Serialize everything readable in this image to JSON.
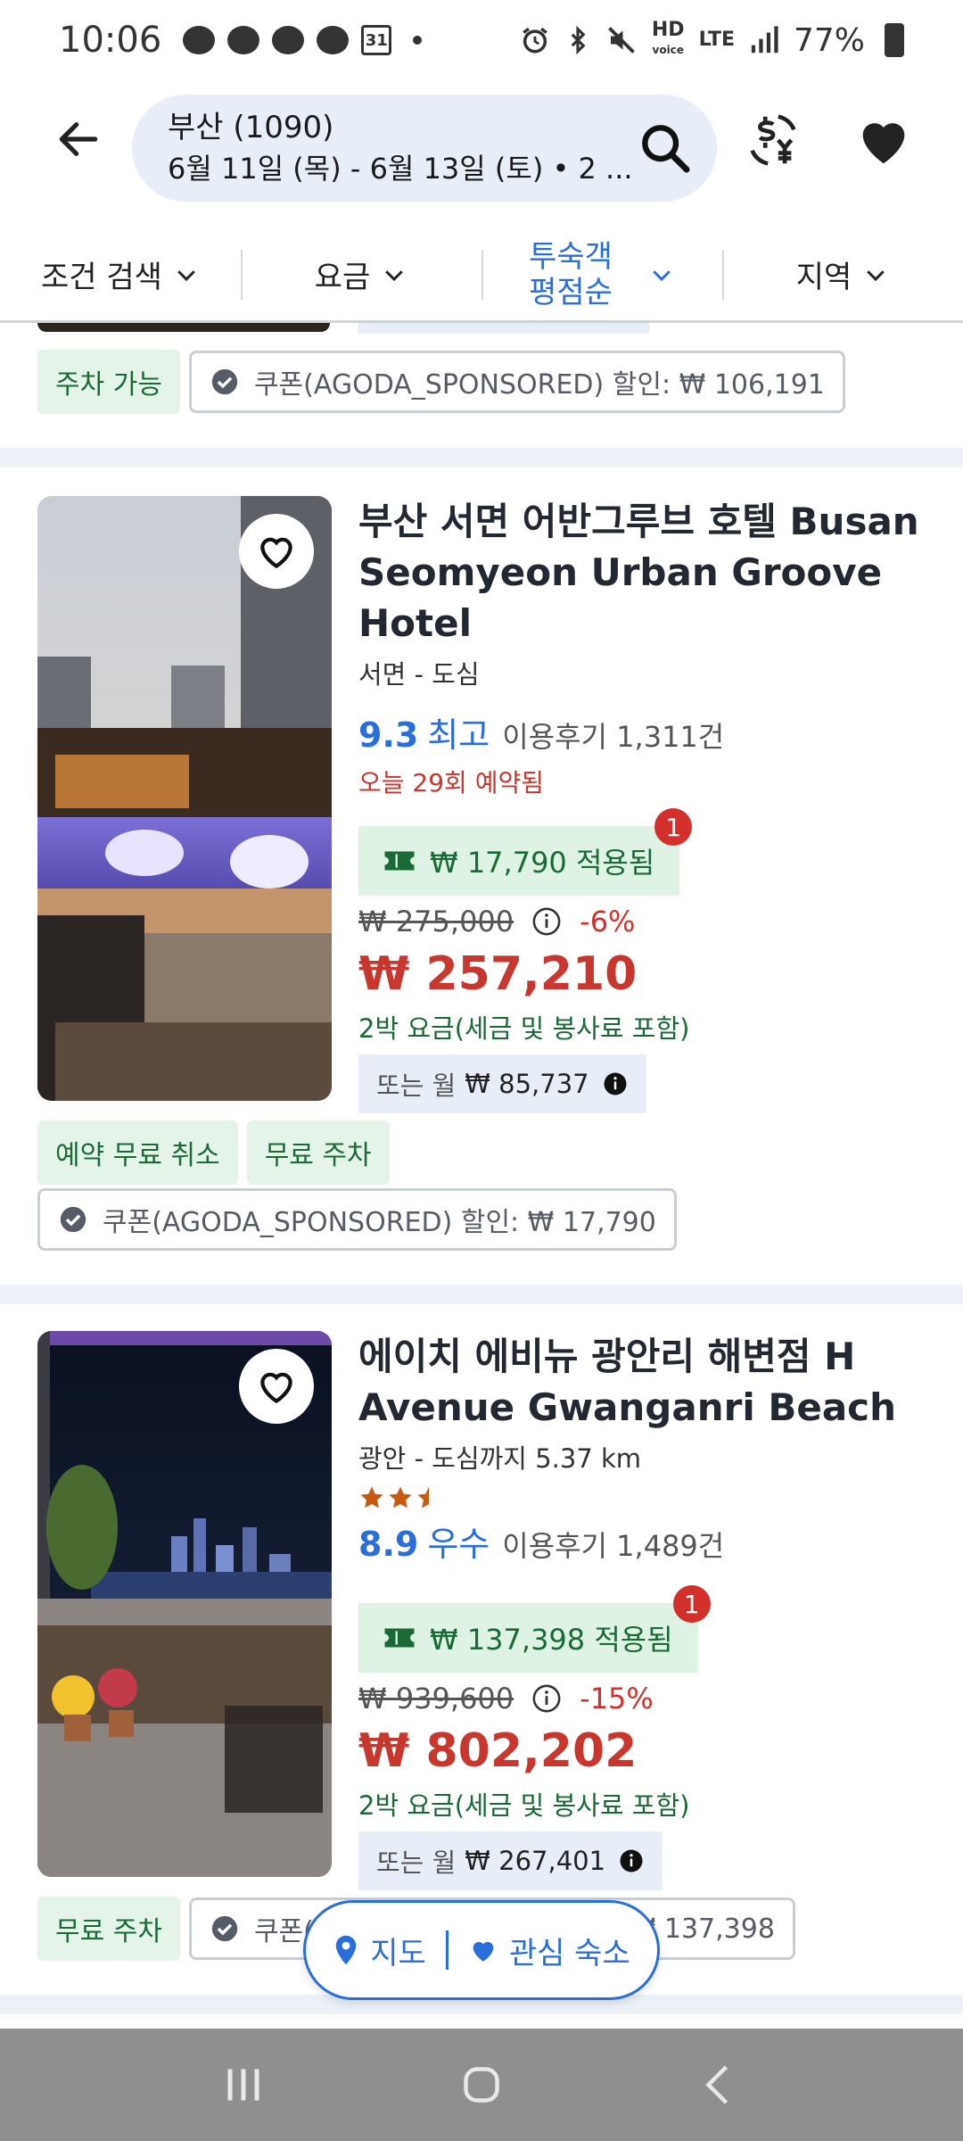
{
  "status_bar": {
    "time": "10:06",
    "calendar_day": "31",
    "network_hd": "HD",
    "network_voice": "voice",
    "network_lte": "LTE",
    "battery": "77%"
  },
  "header": {
    "search_title": "부산 (1090)",
    "search_subtitle": "6월 11일 (목) - 6월 13일 (토) • 2 ..."
  },
  "filters": {
    "filter_label": "조건 검색",
    "price_label": "요금",
    "sort_line1": "투숙객",
    "sort_line2": "평점순",
    "area_label": "지역"
  },
  "top_partial": {
    "tag": "주차 가능",
    "coupon": "쿠폰(AGODA_SPONSORED) 할인: ₩ 106,191"
  },
  "hotels": [
    {
      "name": "부산 서면 어반그루브 호텔 Busan Seomyeon Urban Groove Hotel",
      "area": "서면 - 도심",
      "score": "9.3",
      "score_word": "최고",
      "reviews": "이용후기 1,311건",
      "booked_today": "오늘 29회 예약됨",
      "applied": "₩ 17,790 적용됨",
      "badge": "1",
      "original_price": "₩ 275,000",
      "discount": "-6%",
      "final_price": "₩ 257,210",
      "tax_note": "2박 요금(세금 및 봉사료 포함)",
      "monthly_label": "또는 월",
      "monthly_amount": "₩ 85,737",
      "tags": [
        "예약 무료 취소",
        "무료 주차"
      ],
      "coupon": "쿠폰(AGODA_SPONSORED) 할인: ₩ 17,790"
    },
    {
      "name": "에이치 에비뉴 광안리 해변점 H Avenue Gwanganri Beach",
      "area": "광안 - 도심까지 5.37 km",
      "stars": 2.5,
      "score": "8.9",
      "score_word": "우수",
      "reviews": "이용후기 1,489건",
      "applied": "₩ 137,398 적용됨",
      "badge": "1",
      "original_price": "₩ 939,600",
      "discount": "-15%",
      "final_price": "₩ 802,202",
      "tax_note": "2박 요금(세금 및 봉사료 포함)",
      "monthly_label": "또는 월",
      "monthly_amount": "₩ 267,401",
      "tags": [
        "무료 주차"
      ],
      "coupon_prefix": "쿠폰(",
      "coupon_suffix": "₩ 137,398"
    }
  ],
  "floating": {
    "map_label": "지도",
    "favorites_label": "관심 숙소"
  },
  "colors": {
    "accent_blue": "#2a6edb",
    "price_red": "#c8372d",
    "green_text": "#1a6a36",
    "green_bg": "#dff3e4"
  }
}
